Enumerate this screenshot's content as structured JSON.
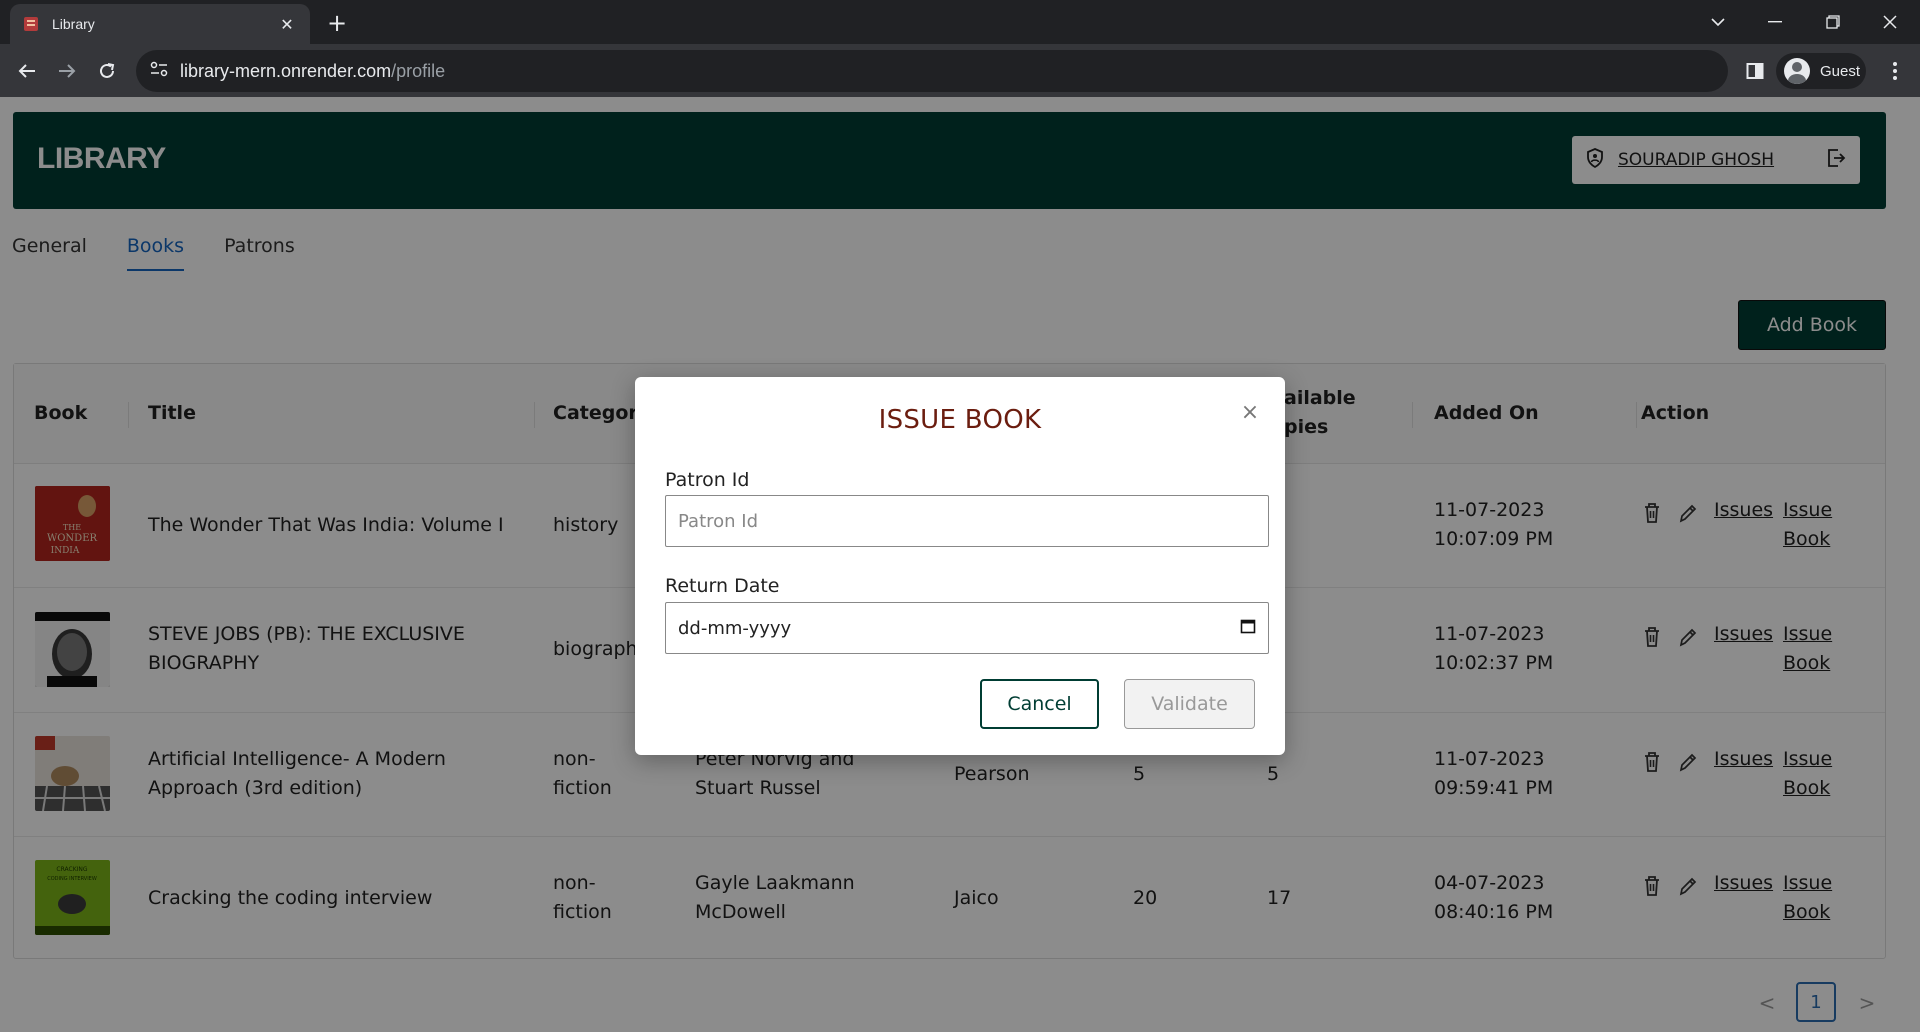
{
  "browser": {
    "tab_title": "Library",
    "url_host": "library-mern.onrender.com",
    "url_path": "/profile",
    "profile_label": "Guest"
  },
  "header": {
    "brand": "LIBRARY",
    "user_name": "SOURADIP GHOSH"
  },
  "tabs": [
    {
      "label": "General"
    },
    {
      "label": "Books"
    },
    {
      "label": "Patrons"
    }
  ],
  "active_tab": "Books",
  "add_book_label": "Add Book",
  "table": {
    "columns": {
      "book": "Book",
      "title": "Title",
      "category": "Category",
      "available_partial_1": "ailable",
      "available_partial_2": "pies",
      "added_on": "Added On",
      "action": "Action"
    },
    "rows": [
      {
        "title": "The Wonder That Was India: Volume I",
        "category": "history",
        "added_date": "11-07-2023",
        "added_time": "10:07:09 PM",
        "cover_text_1": "THE",
        "cover_text_2": "WONDER",
        "cover_text_3": "INDIA"
      },
      {
        "title_line1": "STEVE JOBS (PB): THE EXCLUSIVE",
        "title_line2": "BIOGRAPHY",
        "category": "biograph",
        "added_date": "11-07-2023",
        "added_time": "10:02:37 PM"
      },
      {
        "title_line1": "Artificial Intelligence- A Modern",
        "title_line2": "Approach (3rd edition)",
        "category_line1": "non-",
        "category_line2": "fiction",
        "author_line1": "Peter Norvig and",
        "author_line2": "Stuart Russel",
        "publisher": "Pearson",
        "copies": "5",
        "available": "5",
        "added_date": "11-07-2023",
        "added_time": "09:59:41 PM"
      },
      {
        "title": "Cracking the coding interview",
        "category_line1": "non-",
        "category_line2": "fiction",
        "author_line1": "Gayle Laakmann",
        "author_line2": "McDowell",
        "publisher": "Jaico",
        "copies": "20",
        "available": "17",
        "added_date": "04-07-2023",
        "added_time": "08:40:16 PM",
        "cover_text_1": "CRACKING",
        "cover_text_2": "CODING INTERVIEW"
      }
    ],
    "action_labels": {
      "issues": "Issues",
      "issue_line1": "Issue",
      "issue_line2": "Book"
    }
  },
  "pagination": {
    "prev": "<",
    "current": "1",
    "next": ">"
  },
  "modal": {
    "title": "ISSUE BOOK",
    "close": "×",
    "patron_label": "Patron Id",
    "patron_placeholder": "Patron Id",
    "return_label": "Return Date",
    "return_value": "dd-mm-yyyy",
    "cancel_label": "Cancel",
    "validate_label": "Validate"
  },
  "colors": {
    "brand": "#003d33",
    "modal_title": "#6b1d0f",
    "active_tab": "#1565c0"
  }
}
